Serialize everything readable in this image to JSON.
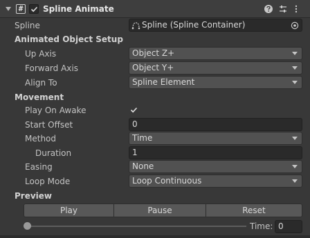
{
  "header": {
    "title": "Spline Animate",
    "enabled": true,
    "icons": [
      "foldout-arrow",
      "script-icon",
      "help-icon",
      "preset-icon",
      "kebab-menu-icon"
    ]
  },
  "fields": {
    "spline": {
      "label": "Spline",
      "value": "Spline (Spline Container)"
    },
    "animated_object_setup": {
      "title": "Animated Object Setup"
    },
    "up_axis": {
      "label": "Up Axis",
      "value": "Object Z+"
    },
    "forward_axis": {
      "label": "Forward Axis",
      "value": "Object Y+"
    },
    "align_to": {
      "label": "Align To",
      "value": "Spline Element"
    },
    "movement": {
      "title": "Movement"
    },
    "play_on_awake": {
      "label": "Play On Awake",
      "checked": true
    },
    "start_offset": {
      "label": "Start Offset",
      "value": "0"
    },
    "method": {
      "label": "Method",
      "value": "Time"
    },
    "duration": {
      "label": "Duration",
      "value": "1"
    },
    "easing": {
      "label": "Easing",
      "value": "None"
    },
    "loop_mode": {
      "label": "Loop Mode",
      "value": "Loop Continuous"
    }
  },
  "preview": {
    "title": "Preview",
    "play_label": "Play",
    "pause_label": "Pause",
    "reset_label": "Reset",
    "time_label": "Time:",
    "time_value": "0",
    "slider_fraction": 0
  },
  "colors": {
    "background": "#383838",
    "header": "#3e3e3e",
    "dropdown": "#515151",
    "field": "#2a2a2a",
    "button": "#585858"
  }
}
